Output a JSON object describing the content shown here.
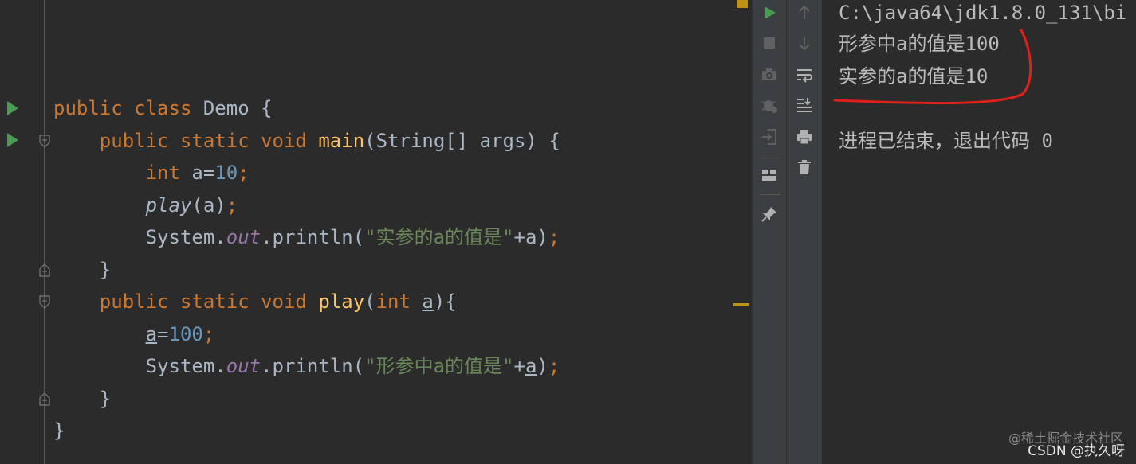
{
  "editor": {
    "lines": [
      {
        "id": "l1",
        "tokens": [
          {
            "t": "public class ",
            "c": "kw"
          },
          {
            "t": "Demo {",
            "c": ""
          }
        ]
      },
      {
        "id": "l2",
        "tokens": [
          {
            "t": "    public static void ",
            "c": "kw"
          },
          {
            "t": "main",
            "c": "fn"
          },
          {
            "t": "(String[] args) {",
            "c": ""
          }
        ]
      },
      {
        "id": "l3",
        "tokens": [
          {
            "t": "        int ",
            "c": "kw"
          },
          {
            "t": "a=",
            "c": ""
          },
          {
            "t": "10",
            "c": "num"
          },
          {
            "t": ";",
            "c": "kw"
          }
        ]
      },
      {
        "id": "l4",
        "tokens": [
          {
            "t": "        ",
            "c": ""
          },
          {
            "t": "play",
            "c": "ital"
          },
          {
            "t": "(a)",
            "c": ""
          },
          {
            "t": ";",
            "c": "kw"
          }
        ]
      },
      {
        "id": "l5",
        "tokens": [
          {
            "t": "        System.",
            "c": ""
          },
          {
            "t": "out",
            "c": "stat"
          },
          {
            "t": ".println(",
            "c": ""
          },
          {
            "t": "\"实参的a的值是\"",
            "c": "str"
          },
          {
            "t": "+a)",
            "c": ""
          },
          {
            "t": ";",
            "c": "kw"
          }
        ]
      },
      {
        "id": "l6",
        "tokens": [
          {
            "t": "    }",
            "c": ""
          }
        ]
      },
      {
        "id": "l7",
        "tokens": [
          {
            "t": "    public static void ",
            "c": "kw"
          },
          {
            "t": "play",
            "c": "fn"
          },
          {
            "t": "(",
            "c": ""
          },
          {
            "t": "int ",
            "c": "kw"
          },
          {
            "t": "a",
            "c": "ul"
          },
          {
            "t": "){",
            "c": ""
          }
        ]
      },
      {
        "id": "l8",
        "tokens": [
          {
            "t": "        ",
            "c": ""
          },
          {
            "t": "a",
            "c": "ul"
          },
          {
            "t": "=",
            "c": ""
          },
          {
            "t": "100",
            "c": "num"
          },
          {
            "t": ";",
            "c": "kw"
          }
        ]
      },
      {
        "id": "l9",
        "tokens": [
          {
            "t": "        System.",
            "c": ""
          },
          {
            "t": "out",
            "c": "stat"
          },
          {
            "t": ".println(",
            "c": ""
          },
          {
            "t": "\"形参中a的值是\"",
            "c": "str"
          },
          {
            "t": "+",
            "c": ""
          },
          {
            "t": "a",
            "c": "ul"
          },
          {
            "t": ")",
            "c": ""
          },
          {
            "t": ";",
            "c": "kw"
          }
        ]
      },
      {
        "id": "l10",
        "tokens": [
          {
            "t": "    }",
            "c": ""
          }
        ]
      },
      {
        "id": "l11",
        "tokens": [
          {
            "t": "}",
            "c": ""
          }
        ]
      }
    ]
  },
  "toolbar_left": {
    "icons": [
      "rerun-icon",
      "stop-icon",
      "camera-icon",
      "debug-settings-icon",
      "exit-icon",
      "layout-icon",
      "pin-icon"
    ]
  },
  "toolbar_right": {
    "icons": [
      "up-arrow-icon",
      "down-arrow-icon",
      "soft-wrap-icon",
      "scroll-to-end-icon",
      "print-icon",
      "trash-icon"
    ]
  },
  "console": {
    "path": "C:\\java64\\jdk1.8.0_131\\bi",
    "output_1": "形参中a的值是100",
    "output_2": "实参的a的值是10",
    "exit_message": "进程已结束，退出代码 0"
  },
  "watermark": {
    "line1": "@稀土掘金技术社区",
    "line2": "CSDN @执久呀"
  },
  "colors": {
    "keyword": "#cc7832",
    "function": "#ffc66d",
    "number": "#6897bb",
    "string": "#6a8759",
    "static_field": "#9876aa",
    "run_green": "#499c54",
    "annotation_red": "#e0201a"
  }
}
